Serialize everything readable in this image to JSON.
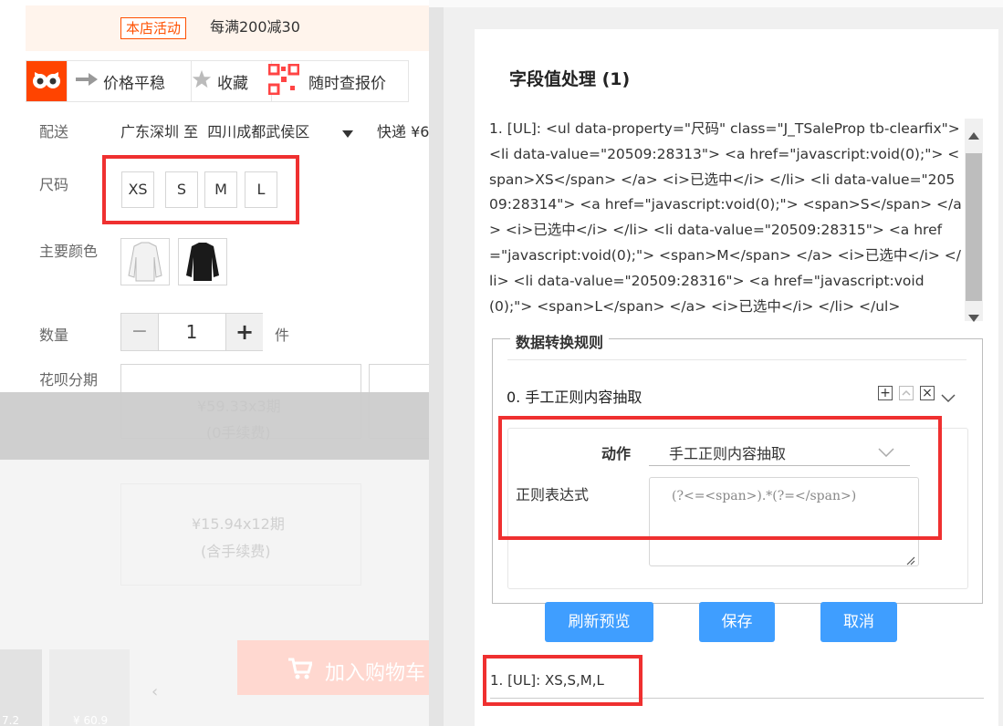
{
  "product": {
    "promo_tag": "本店活动",
    "promo_text": "每满200减30",
    "strip": {
      "price_stable": "价格平稳",
      "favorite": "收藏",
      "check_price": "随时查报价"
    },
    "delivery": {
      "label": "配送",
      "route": "广东深圳 至  四川成都武侯区",
      "express": "快递 ¥6"
    },
    "size": {
      "label": "尺码",
      "options": [
        "XS",
        "S",
        "M",
        "L"
      ]
    },
    "color": {
      "label": "主要颜色"
    },
    "quantity": {
      "label": "数量",
      "minus": "−",
      "value": "1",
      "plus": "+",
      "unit": "件"
    },
    "installment": {
      "label": "花呗分期",
      "opt1_amount": "¥59.33x3期",
      "opt1_fee": "(0手续费)",
      "opt2_amount": "¥15.94x12期",
      "opt2_fee": "(含手续费)"
    },
    "cart_button": "加入购物车",
    "thumb_prices": [
      "7.2",
      "¥ 60.9"
    ]
  },
  "dialog": {
    "title": "字段值处理 (1)",
    "preview_code": "1. [UL]: <ul data-property=\"尺码\" class=\"J_TSaleProp tb-clearfix\"> <li data-value=\"20509:28313\"> <a href=\"javascript:void(0);\"> <span>XS</span> </a> <i>已选中</i> </li> <li data-value=\"20509:28314\"> <a href=\"javascript:void(0);\"> <span>S</span> </a> <i>已选中</i> </li> <li data-value=\"20509:28315\"> <a href=\"javascript:void(0);\"> <span>M</span> </a> <i>已选中</i> </li> <li data-value=\"20509:28316\"> <a href=\"javascript:void(0);\"> <span>L</span> </a> <i>已选中</i> </li> </ul>",
    "rules_legend": "数据转换规则",
    "rule_title": "0. 手工正则内容抽取",
    "action_label": "动作",
    "action_value": "手工正则内容抽取",
    "regex_label": "正则表达式",
    "regex_value": "(?<=<span>).*(?=</span>)",
    "buttons": {
      "refresh": "刷新预览",
      "save": "保存",
      "cancel": "取消"
    },
    "result": "1. [UL]:  XS,S,M,L"
  },
  "colors": {
    "accent": "#ff5000",
    "primary_button": "#3f9eff",
    "highlight_frame": "#ef3030"
  }
}
